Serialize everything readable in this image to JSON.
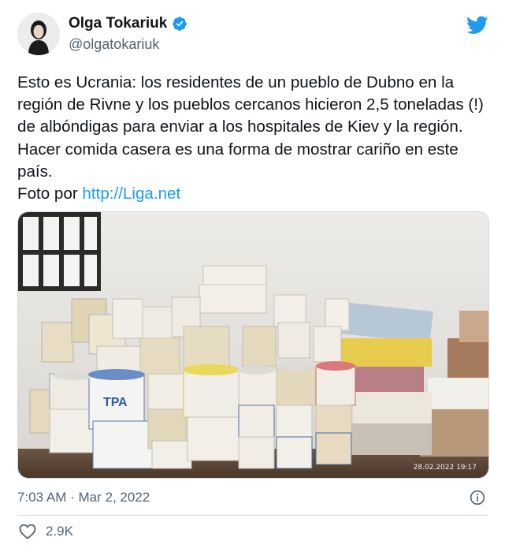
{
  "user": {
    "name": "Olga Tokariuk",
    "handle": "@olgatokariuk"
  },
  "tweet": {
    "text": "Esto es Ucrania: los residentes de un pueblo de Dubno en la región de Rivne y los pueblos cercanos hicieron 2,5 toneladas (!) de albóndigas para enviar a los hospitales de Kiev y la región. Hacer comida casera es una forma de mostrar cariño en este país.",
    "photo_credit_prefix": "Foto por ",
    "link": "http://Liga.net",
    "photo_timestamp": "28.02.2022 19:17",
    "tub_label": "ТРА"
  },
  "meta": {
    "time": "7:03 AM",
    "separator": " · ",
    "date": "Mar 2, 2022"
  },
  "engagement": {
    "likes": "2.9K"
  },
  "colors": {
    "accent": "#1d9bf0",
    "text": "#0f1419",
    "muted": "#536471"
  }
}
